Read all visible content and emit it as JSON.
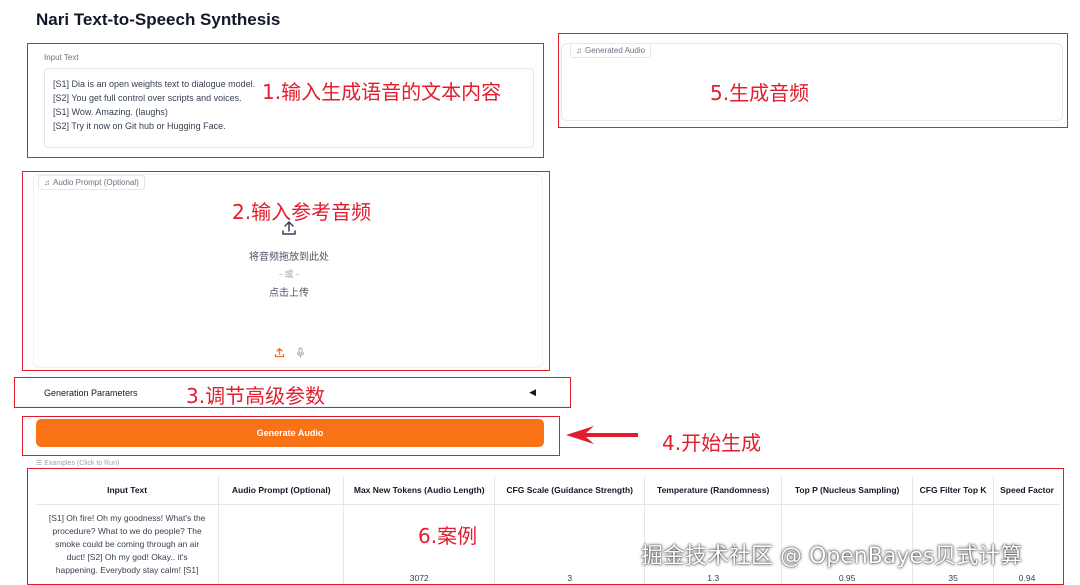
{
  "page": {
    "title": "Nari Text-to-Speech Synthesis"
  },
  "input_text": {
    "label": "Input Text",
    "lines": [
      "[S1] Dia is an open weights text to dialogue model.",
      "[S2] You get full control over scripts and voices.",
      "[S1] Wow. Amazing. (laughs)",
      "[S2] Try it now on Git hub or Hugging Face."
    ]
  },
  "generated_audio": {
    "label": "Generated Audio",
    "icon": "music-note-icon"
  },
  "audio_prompt": {
    "label": "Audio Prompt (Optional)",
    "icon": "music-note-icon",
    "drop_text": "将音频拖放到此处",
    "or_text": "- 或 -",
    "click_text": "点击上传"
  },
  "parameters": {
    "label": "Generation Parameters",
    "toggle": "◀"
  },
  "generate": {
    "label": "Generate Audio",
    "color": "#f97316"
  },
  "examples": {
    "label": "☰ Examples (Click to Run)",
    "columns": [
      "Input Text",
      "Audio Prompt (Optional)",
      "Max New Tokens (Audio Length)",
      "CFG Scale (Guidance Strength)",
      "Temperature (Randomness)",
      "Top P (Nucleus Sampling)",
      "CFG Filter Top K",
      "Speed Factor"
    ],
    "row": {
      "input_lines": [
        "[S1] Oh fire! Oh my goodness! What's the",
        "procedure? What to we do people? The",
        "smoke could be coming through an air",
        "duct! [S2] Oh my god! Okay.. it's",
        "happening. Everybody stay calm! [S1]"
      ],
      "audio_prompt": "",
      "max_new_tokens": "3072",
      "cfg_scale": "3",
      "temperature": "1.3",
      "top_p": "0.95",
      "cfg_filter_top_k": "35",
      "speed_factor": "0.94"
    }
  },
  "annotations": {
    "a1": "1.输入生成语音的文本内容",
    "a2": "2.输入参考音频",
    "a3": "3.调节高级参数",
    "a4": "4.开始生成",
    "a5": "5.生成音频",
    "a6": "6.案例",
    "color": "#e11d2e"
  },
  "watermark": "掘金技术社区 @ OpenBayes贝式计算"
}
